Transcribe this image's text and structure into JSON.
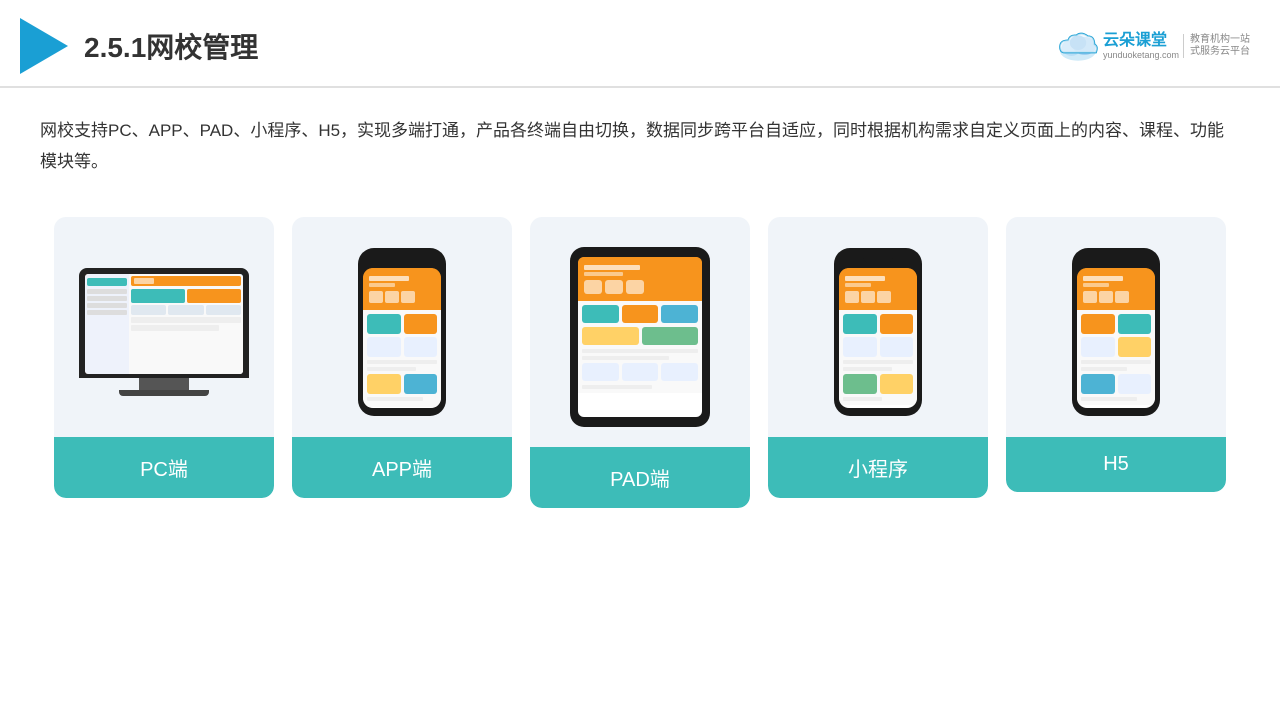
{
  "header": {
    "section_number": "2.5.1",
    "title": "网校管理",
    "brand_name": "云朵课堂",
    "brand_url": "yunduoketang.com",
    "brand_slogan_line1": "教育机构一站",
    "brand_slogan_line2": "式服务云平台"
  },
  "description": {
    "text": "网校支持PC、APP、PAD、小程序、H5，实现多端打通，产品各终端自由切换，数据同步跨平台自适应，同时根据机构需求自定义页面上的内容、课程、功能模块等。"
  },
  "cards": [
    {
      "label": "PC端",
      "device": "pc"
    },
    {
      "label": "APP端",
      "device": "phone"
    },
    {
      "label": "PAD端",
      "device": "tablet"
    },
    {
      "label": "小程序",
      "device": "mini-phone"
    },
    {
      "label": "H5",
      "device": "mini-phone2"
    }
  ]
}
